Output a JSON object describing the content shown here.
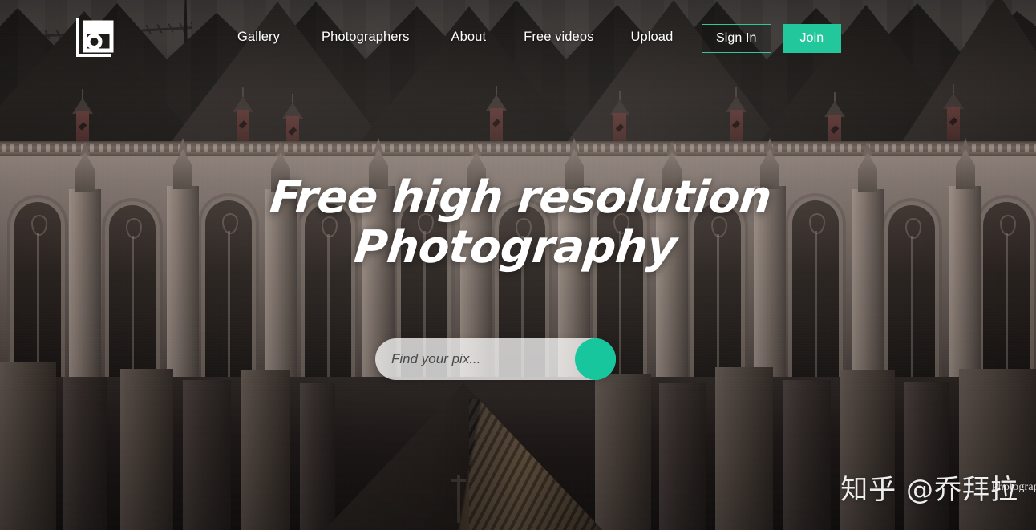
{
  "site": {
    "logo_icon": "camera-square-logo-icon"
  },
  "nav": {
    "items": [
      {
        "label": "Gallery"
      },
      {
        "label": "Photographers"
      },
      {
        "label": "About"
      },
      {
        "label": "Free videos"
      },
      {
        "label": "Upload"
      }
    ]
  },
  "auth": {
    "sign_in_label": "Sign In",
    "join_label": "Join"
  },
  "hero": {
    "title_line1": "Free high resolution",
    "title_line2": "Photography"
  },
  "search": {
    "placeholder": "Find your pix...",
    "value": "",
    "button_icon": "search-icon"
  },
  "credit": {
    "text": "Photograp"
  },
  "watermark": {
    "text": "知乎 @乔拜拉"
  },
  "colors": {
    "accent_teal": "#23c79c",
    "accent_teal_button": "#18c69d",
    "signin_border": "#2fc79c",
    "nav_text": "#ffffff",
    "hero_text": "#ffffff",
    "search_bg": "rgba(255,255,255,0.74)",
    "placeholder_text": "#4a4a4a"
  }
}
